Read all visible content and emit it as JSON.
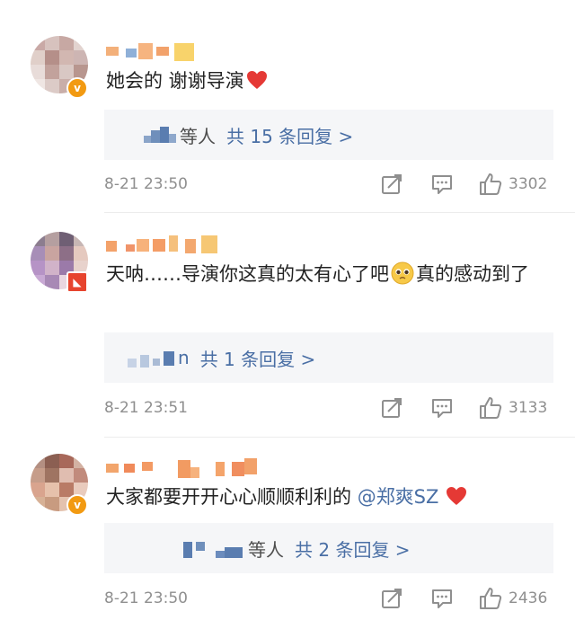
{
  "comments": [
    {
      "text": "她会的 谢谢导演",
      "reply_suffix": "等人",
      "reply_link": "共 15 条回复 >",
      "timestamp": "8-21 23:50",
      "likes": "3302",
      "icons": {
        "share": "share-icon",
        "comment": "comment-icon",
        "like": "thumbs-up-icon",
        "heart": "red-heart-emoji"
      }
    },
    {
      "text_before_emoji": "天呐……导演你这真的太有心了吧",
      "text_after_emoji": "真的感动到了",
      "reply_suffix": "n",
      "reply_link": "共 1 条回复 >",
      "timestamp": "8-21 23:51",
      "likes": "3133",
      "icons": {
        "share": "share-icon",
        "comment": "comment-icon",
        "like": "thumbs-up-icon",
        "emoji": "pleading-face-emoji"
      }
    },
    {
      "text": "大家都要开开心心顺顺利利的 ",
      "mention": "@郑爽SZ",
      "reply_suffix": "等人",
      "reply_link": "共 2 条回复 >",
      "timestamp": "8-21 23:50",
      "likes": "2436",
      "icons": {
        "share": "share-icon",
        "comment": "comment-icon",
        "like": "thumbs-up-icon",
        "heart": "red-heart-emoji"
      }
    }
  ],
  "colors": {
    "link": "#4a6fa5",
    "meta": "#8f8f8f",
    "reply_bg": "#f5f6f8",
    "verified_badge": "#f29a12",
    "heart": "#e53935"
  }
}
